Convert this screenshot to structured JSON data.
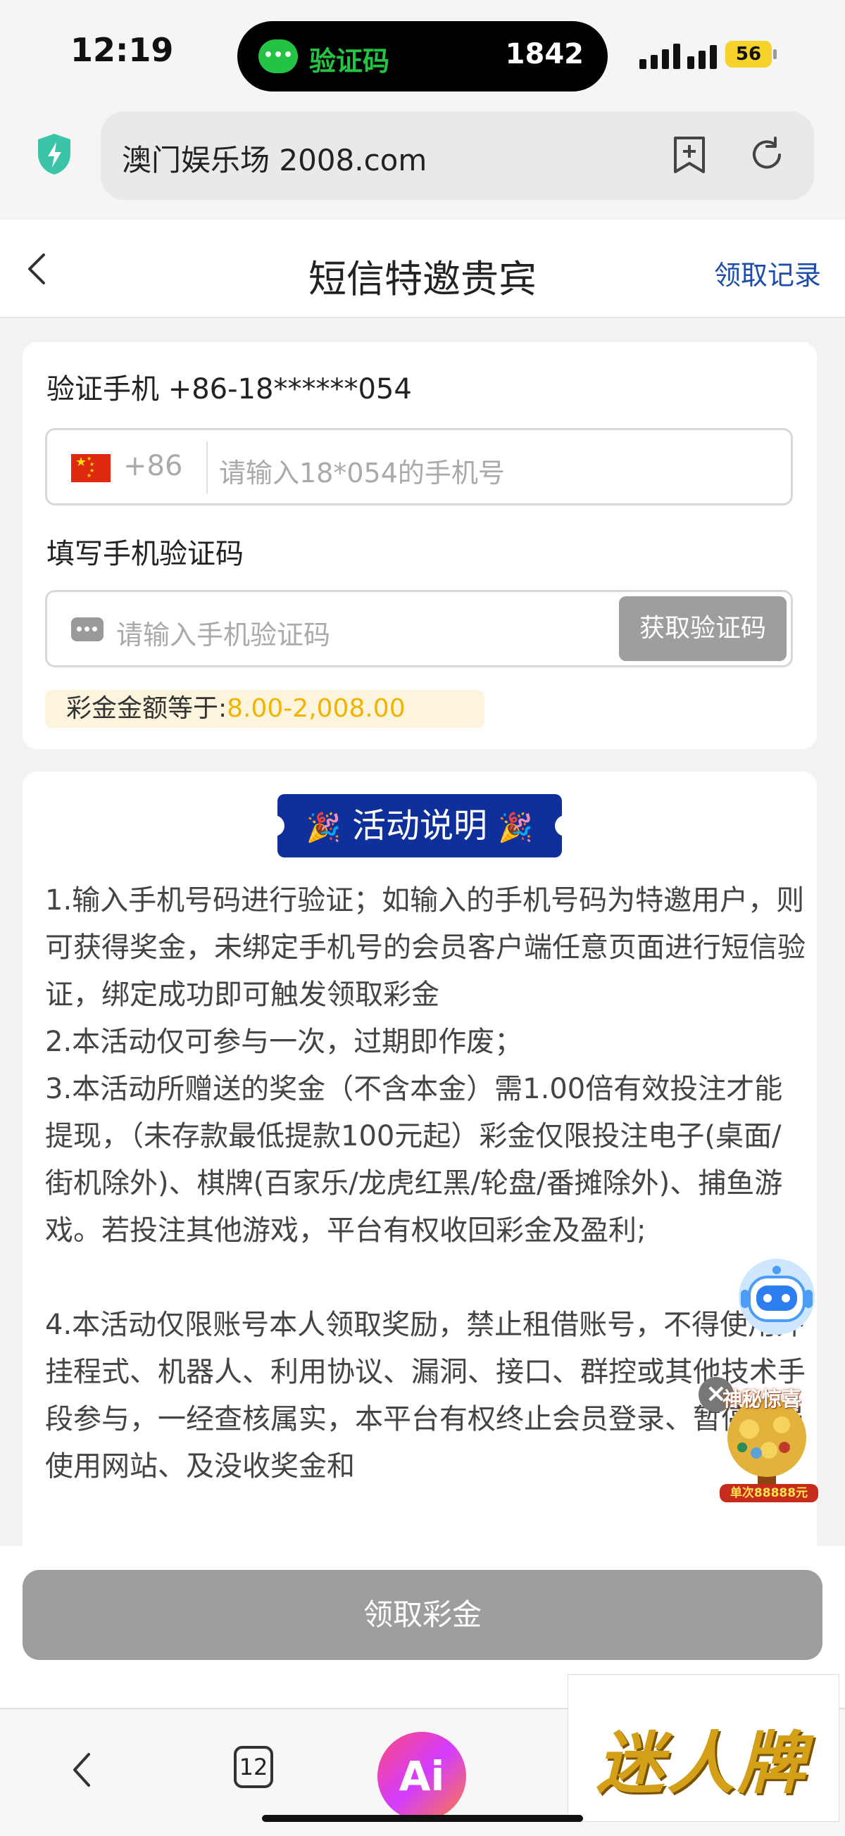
{
  "status_bar": {
    "time": "12:19",
    "island_label": "验证码",
    "island_code": "1842",
    "battery": "56"
  },
  "browser": {
    "url": "澳门娱乐场 2008.com",
    "tab_count": "12",
    "ai_label": "Ai"
  },
  "header": {
    "title": "短信特邀贵宾",
    "records_link": "领取记录"
  },
  "verify": {
    "phone_label": "验证手机 +86-18******054",
    "country_code": "+86",
    "phone_placeholder": "请输入18*054的手机号",
    "code_label": "填写手机验证码",
    "code_placeholder": "请输入手机验证码",
    "get_code_button": "获取验证码",
    "bonus_label": "彩金金额等于:",
    "bonus_amount": "8.00-2,008.00"
  },
  "activity": {
    "banner_title": "活动说明",
    "rules": [
      "1.输入手机号码进行验证；如输入的手机号码为特邀用户，则可获得奖金，未绑定手机号的会员客户端任意页面进行短信验证，绑定成功即可触发领取彩金",
      "2.本活动仅可参与一次，过期即作废；",
      "3.本活动所赠送的奖金（不含本金）需1.00倍有效投注才能提现，（未存款最低提款100元起）彩金仅限投注电子(桌面/街机除外)、棋牌(百家乐/龙虎红黑/轮盘/番摊除外)、捕鱼游戏。若投注其他游戏，平台有权收回彩金及盈利;",
      "",
      "4.本活动仅限账号本人领取奖励，禁止租借账号，不得使用外挂程式、机器人、利用协议、漏洞、接口、群控或其他技术手段参与，一经查核属实，本平台有权终止会员登录、暂停会员使用网站、及没收奖金和"
    ]
  },
  "promo": {
    "title": "神秘惊喜",
    "subtitle": "单次88888元"
  },
  "footer": {
    "claim_button": "领取彩金"
  },
  "watermark": {
    "text": "迷人牌"
  }
}
